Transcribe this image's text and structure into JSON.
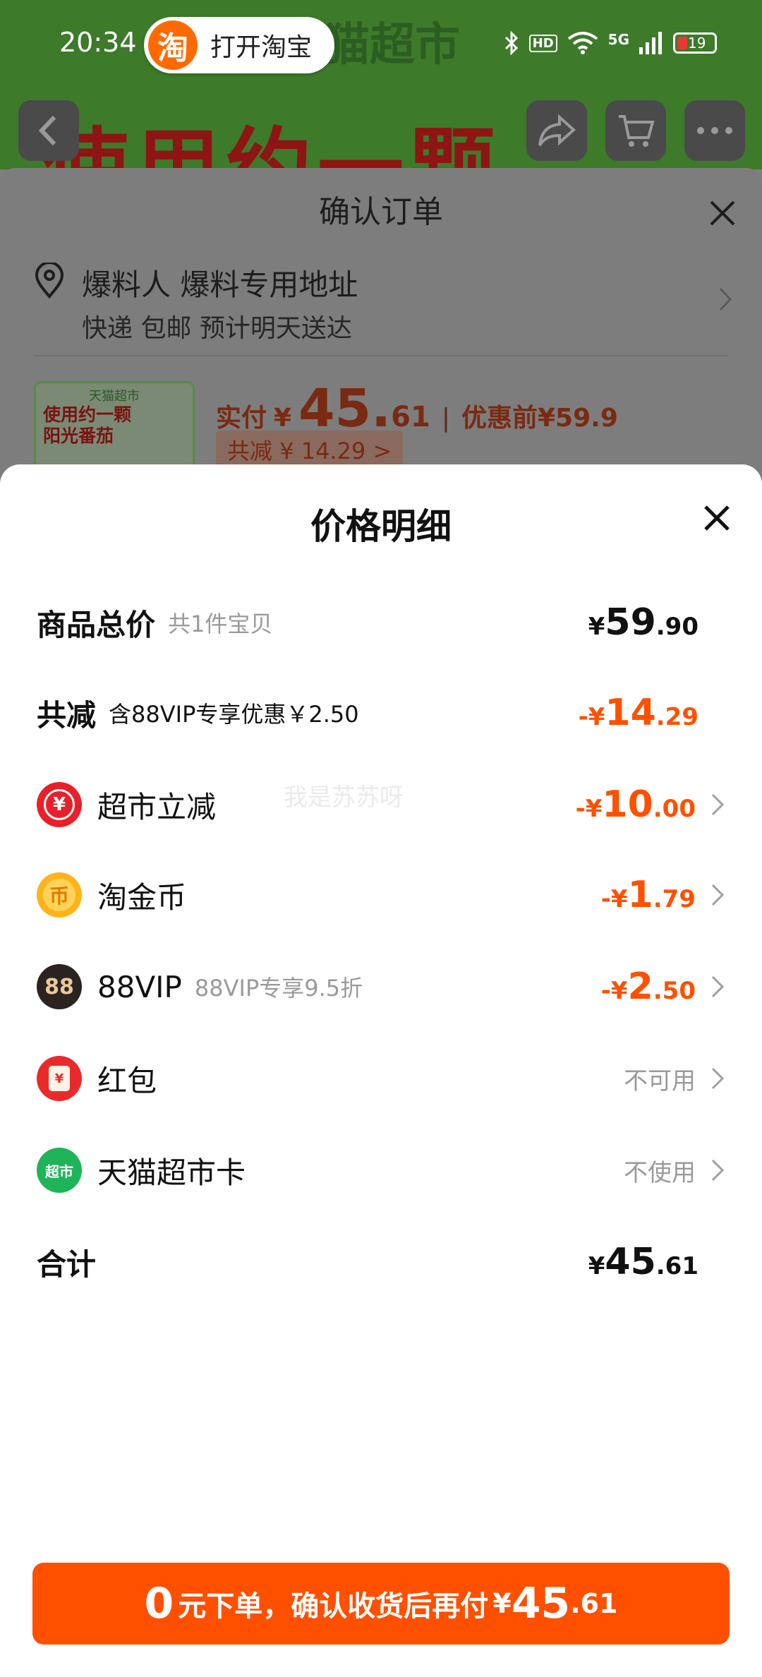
{
  "status_bar": {
    "time": "20:34",
    "taobao_pill": {
      "logo_char": "淘",
      "label": "打开淘宝"
    },
    "indicators": {
      "hd": "HD",
      "network": "5G",
      "battery": "19"
    }
  },
  "background": {
    "banner_text": "使用约一颗",
    "store_text": "猫超市",
    "confirm": {
      "title": "确认订单",
      "address_name": "爆料人 爆料专用地址",
      "address_sub": "快递 包邮 预计明天送达",
      "product_thumb": {
        "store": "天猫超市",
        "line1": "使用约一颗",
        "line2": "阳光番茄"
      },
      "pay_label": "实付",
      "pay_currency": "¥",
      "pay_int": "45.",
      "pay_dec": "61",
      "orig_label": "优惠前",
      "orig_amount": "¥59.9",
      "discount_tag": "共减 ¥ 14.29 >"
    }
  },
  "price_detail": {
    "title": "价格明细",
    "rows": [
      {
        "label": "商品总价",
        "sub": "共1件宝贝",
        "amount": {
          "cur": "¥",
          "int": "59",
          "dec": ".90"
        },
        "tone": "dark"
      },
      {
        "label": "共减",
        "sub": "含88VIP专享优惠￥2.50",
        "amount": {
          "cur": "-¥",
          "int": "14",
          "dec": ".29"
        },
        "tone": "orange"
      },
      {
        "label": "超市立减",
        "icon": "supermarket-discount-icon",
        "icon_glyph": "¥",
        "icon_color": "#e8202a",
        "amount": {
          "cur": "-¥",
          "int": "10",
          "dec": ".00"
        },
        "tone": "orange"
      },
      {
        "label": "淘金币",
        "icon": "taobao-coin-icon",
        "icon_glyph": "币",
        "icon_color": "#ffb31a",
        "amount": {
          "cur": "-¥",
          "int": "1",
          "dec": ".79"
        },
        "tone": "orange"
      },
      {
        "label": "88VIP",
        "sub": "88VIP专享9.5折",
        "icon": "vip88-icon",
        "icon_glyph": "88",
        "icon_color": "#2a2321",
        "amount": {
          "cur": "-¥",
          "int": "2",
          "dec": ".50"
        },
        "tone": "orange"
      },
      {
        "label": "红包",
        "icon": "red-packet-icon",
        "icon_glyph": "¥",
        "icon_color": "#ea2a2a",
        "status": "不可用"
      },
      {
        "label": "天猫超市卡",
        "icon": "tmall-card-icon",
        "icon_glyph": "超市",
        "icon_color": "#1fb45a",
        "status": "不使用"
      },
      {
        "label": "合计",
        "amount": {
          "cur": "¥",
          "int": "45",
          "dec": ".61"
        },
        "tone": "dark"
      }
    ],
    "watermark": "我是苏苏呀",
    "cta": {
      "zero": "0",
      "text": "元下单，确认收货后再付",
      "cur": "¥",
      "int": "45",
      "dec": ".61"
    }
  },
  "colors": {
    "accent": "#ff5000",
    "text": "#111111",
    "muted": "#9a9a9a"
  }
}
